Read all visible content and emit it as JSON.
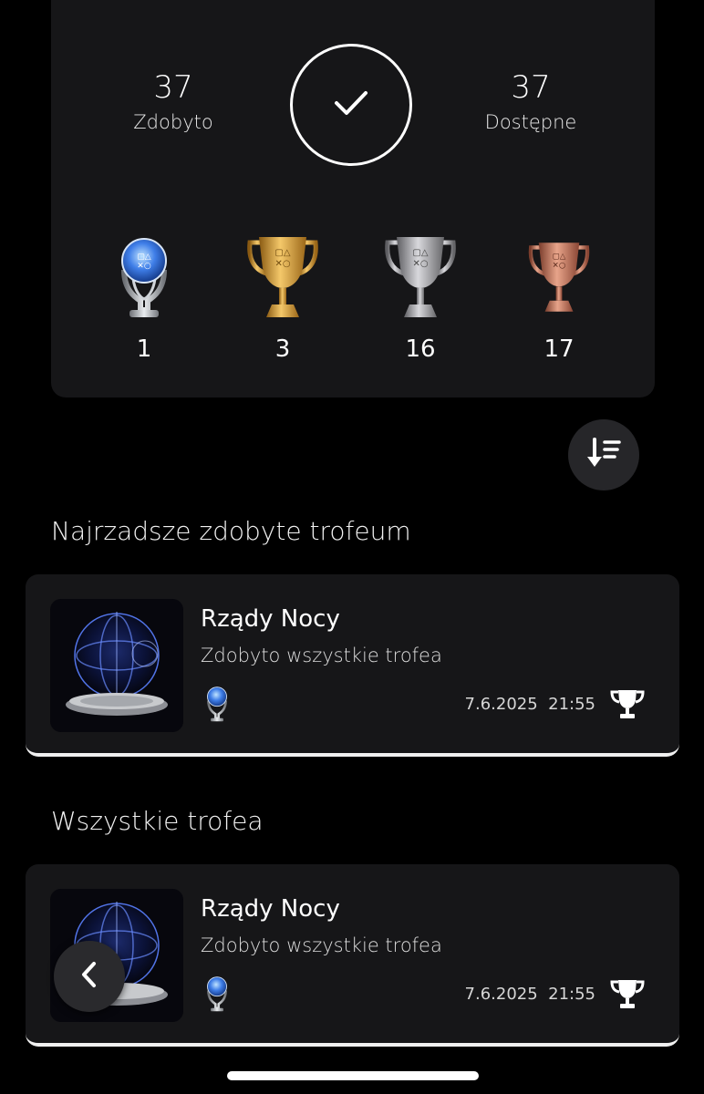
{
  "summary": {
    "earned_value": "37",
    "earned_label": "Zdobyto",
    "available_value": "37",
    "available_label": "Dostępne",
    "trophies": [
      {
        "type": "platinum",
        "count": "1"
      },
      {
        "type": "gold",
        "count": "3"
      },
      {
        "type": "silver",
        "count": "16"
      },
      {
        "type": "bronze",
        "count": "17"
      }
    ]
  },
  "sections": {
    "rarest_title": "Najrzadsze zdobyte trofeum",
    "all_title": "Wszystkie trofea"
  },
  "rarest_card": {
    "title": "Rządy Nocy",
    "subtitle": "Zdobyto wszystkie trofea",
    "date": "7.6.2025",
    "time": "21:55"
  },
  "all_card": {
    "title": "Rządy Nocy",
    "subtitle": "Zdobyto wszystkie trofea",
    "date": "7.6.2025",
    "time": "21:55"
  },
  "icons": {
    "complete": "check-icon",
    "sort": "sort-icon",
    "back": "chevron-left-icon",
    "trophy": "trophy-icon"
  },
  "colors": {
    "background": "#000000",
    "card": "#161618",
    "gold": "#d9a441",
    "silver": "#a9a9ad",
    "bronze": "#c07a62",
    "platinum": "#4a7ee0"
  }
}
